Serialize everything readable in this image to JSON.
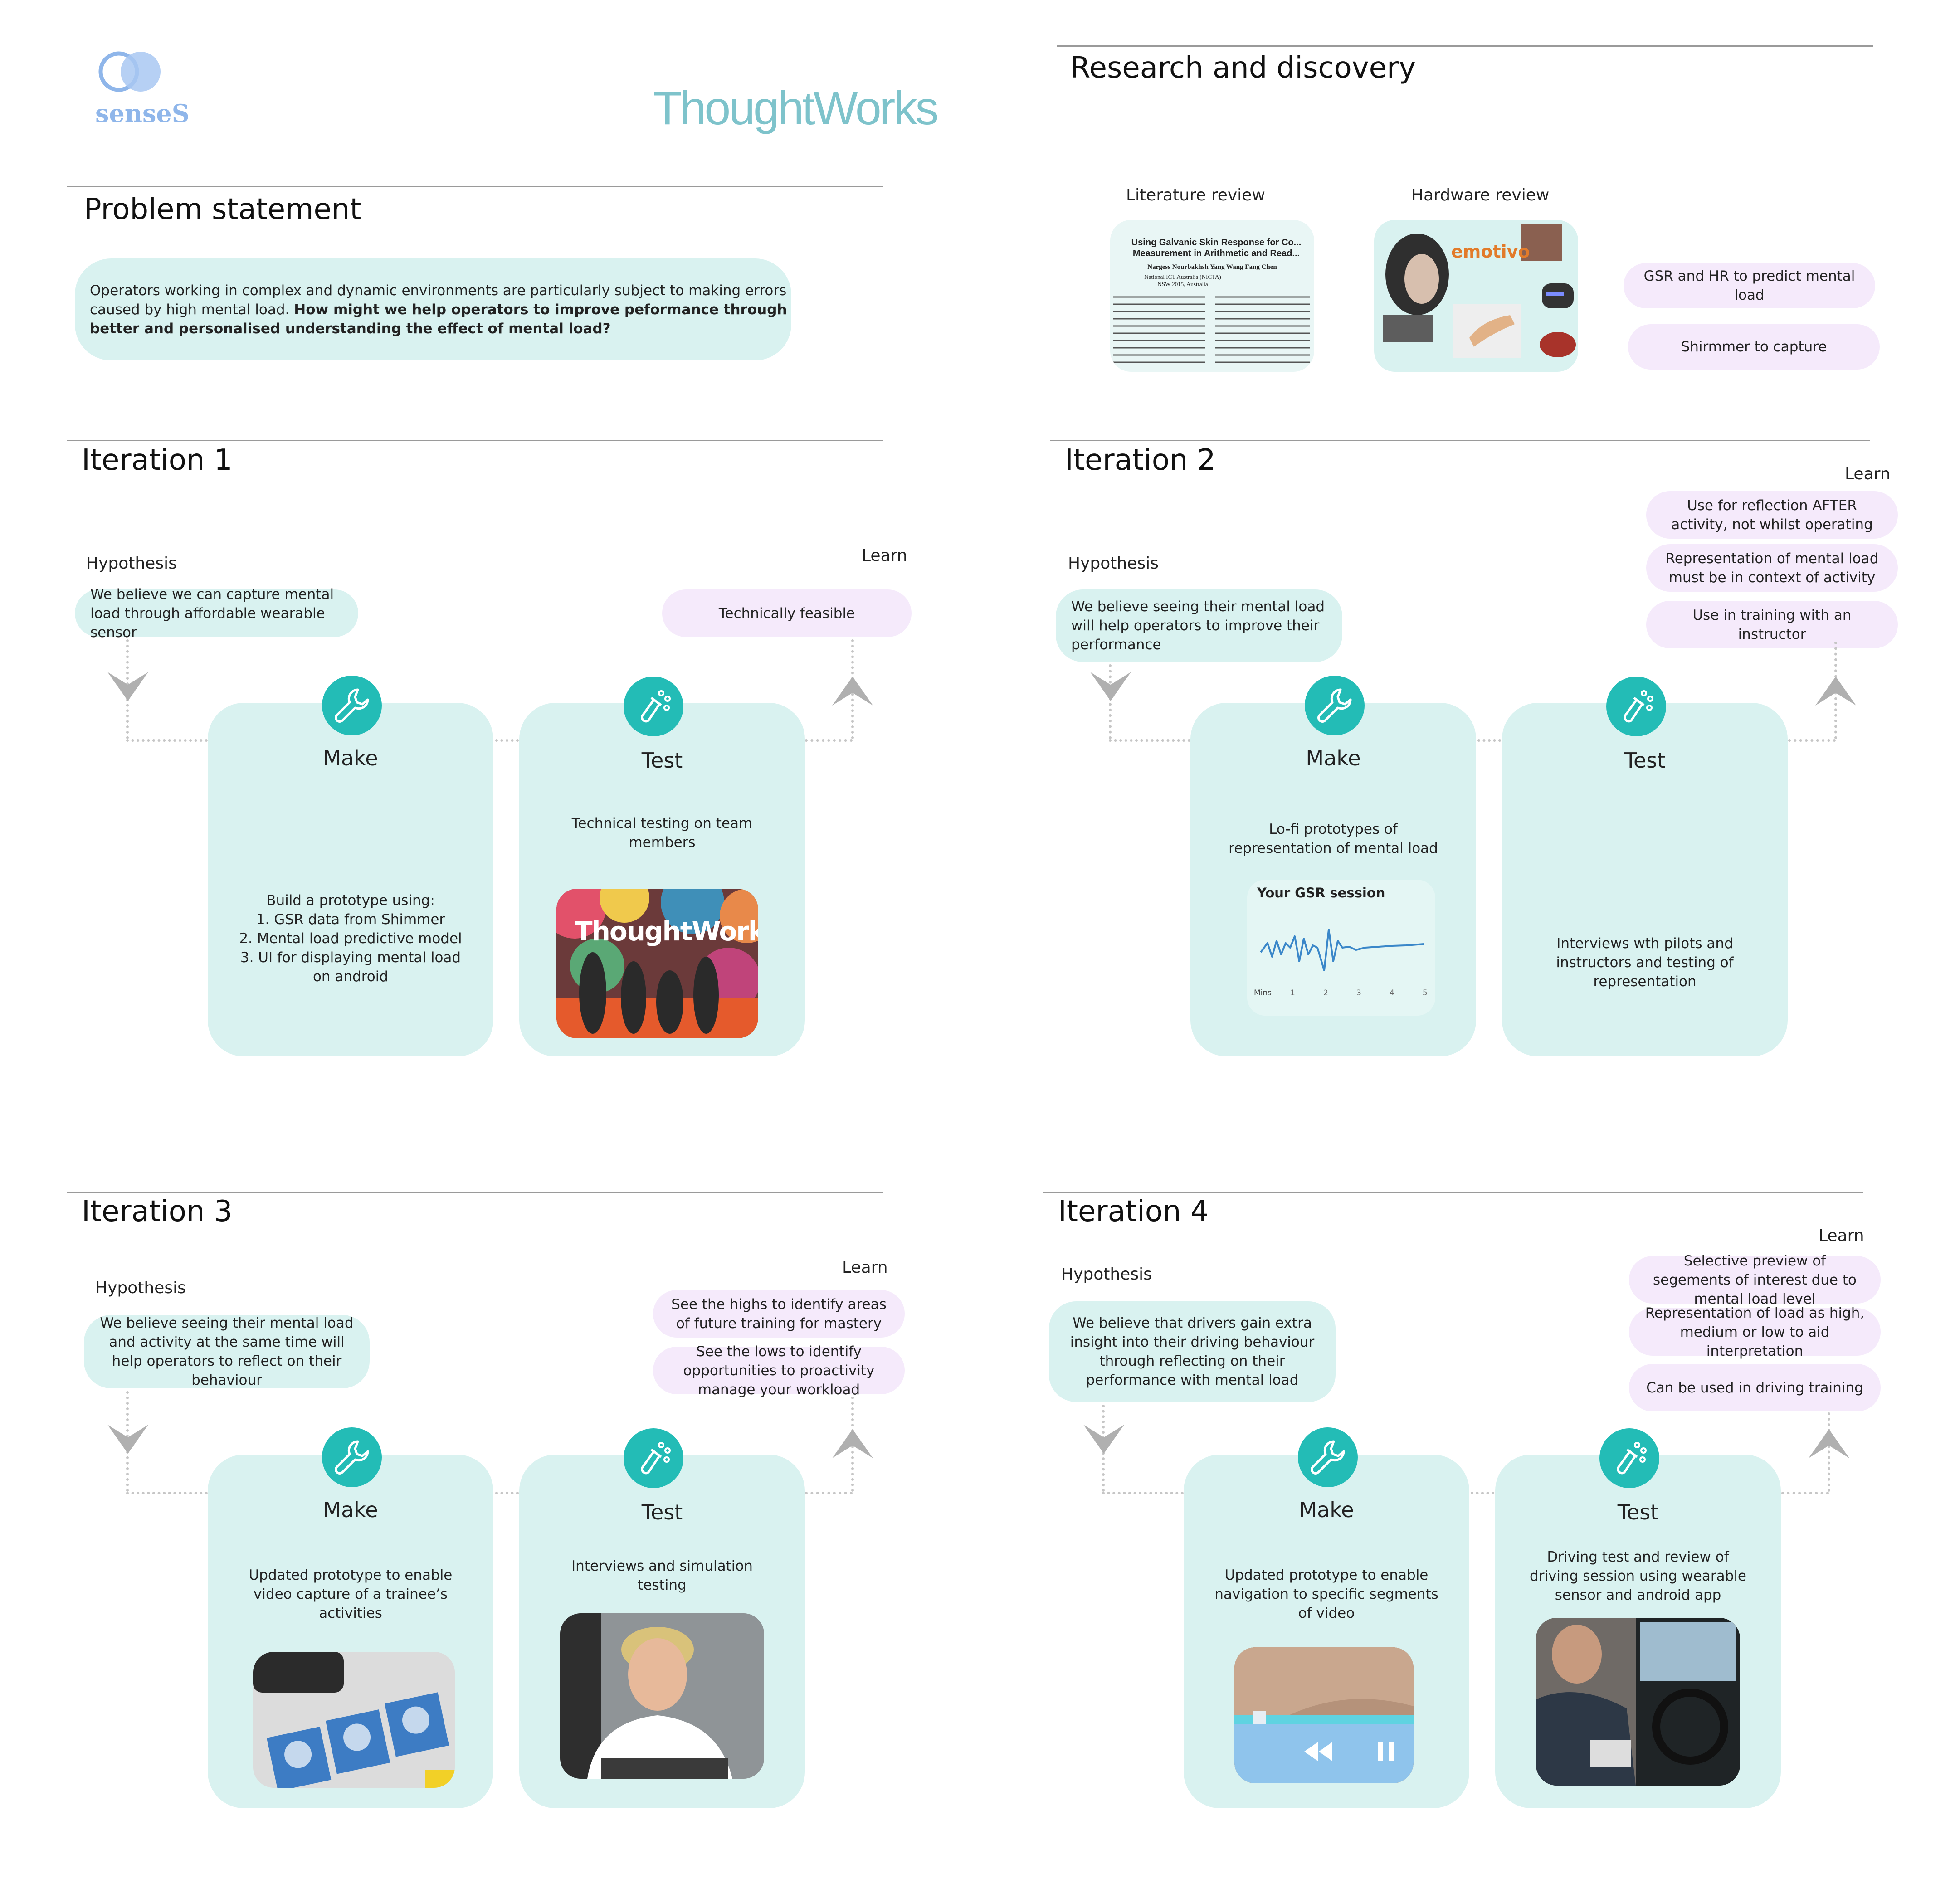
{
  "brand": {
    "logo_text": "senseS",
    "partner_logo": "ThoughtWorks"
  },
  "problem": {
    "title": "Problem statement",
    "text_plain": "Operators working in complex and dynamic environments are particularly subject to making errors caused by high mental load.",
    "text_bold": "How might we help operators to improve peformance through better and personalised understanding the effect of mental load?"
  },
  "research": {
    "title": "Research and discovery",
    "literature_label": "Literature review",
    "hardware_label": "Hardware review",
    "paper_title": "Using Galvanic Skin Response for Co... Measurement in Arithmetic and Read...",
    "paper_authors": "Nargess Nourbakhsh    Yang Wang    Fang Chen",
    "paper_affil": "National ICT Australia (NICTA) NSW 2015, Australia",
    "emotiv_text": "emotivo",
    "findings": [
      "GSR and HR to predict mental load",
      "Shirmmer to capture"
    ]
  },
  "iterations": [
    {
      "title": "Iteration 1",
      "hypothesis_label": "Hypothesis",
      "hypothesis": "We believe we can capture mental load through affordable wearable sensor",
      "learn_label": "Learn",
      "learn": [
        "Technically feasible"
      ],
      "make_title": "Make",
      "make_text": "Build a prototype using:\n1. GSR data from Shimmer\n2. Mental load predictive model\n3. UI for displaying mental load on android",
      "test_title": "Test",
      "test_text": "Technical testing on team members",
      "test_photo_text": "ThoughtWorks"
    },
    {
      "title": "Iteration 2",
      "hypothesis_label": "Hypothesis",
      "hypothesis": "We believe seeing their mental load will help operators  to improve their performance",
      "learn_label": "Learn",
      "learn": [
        "Use for reflection AFTER activity, not whilst operating",
        "Representation of mental load must be in context of activity",
        "Use in training with an instructor"
      ],
      "make_title": "Make",
      "make_text": "Lo-fi prototypes of representation of mental load",
      "gsr_title": "Your GSR session",
      "gsr_x_label": "Mins",
      "gsr_ticks": [
        "1",
        "2",
        "3",
        "4",
        "5"
      ],
      "test_title": "Test",
      "test_text": "Interviews wth pilots and instructors and testing of representation"
    },
    {
      "title": "Iteration 3",
      "hypothesis_label": "Hypothesis",
      "hypothesis": "We believe seeing their mental load and activity at the same time will help operators to reflect on their behaviour",
      "learn_label": "Learn",
      "learn": [
        "See the highs to identify areas of future training for mastery",
        "See the lows to identify opportunities to proactivity manage your workload"
      ],
      "make_title": "Make",
      "make_text": "Updated prototype to enable video capture of a trainee’s activities",
      "test_title": "Test",
      "test_text": "Interviews and simulation testing"
    },
    {
      "title": "Iteration 4",
      "hypothesis_label": "Hypothesis",
      "hypothesis": "We believe that drivers gain extra insight into their driving behaviour through reflecting on their performance with mental load",
      "learn_label": "Learn",
      "learn": [
        "Selective preview of segements of interest due to mental load level",
        "Representation of load as high, medium or low to aid interpretation",
        "Can be used in driving training"
      ],
      "make_title": "Make",
      "make_text": "Updated prototype to enable navigation to specific segments of video",
      "test_title": "Test",
      "test_text": "Driving test and review of driving session using wearable sensor and android app"
    }
  ],
  "colors": {
    "teal_bg": "#d9f2f0",
    "lilac_bg": "#f5eafb",
    "accent": "#23bcb6",
    "logo_blue": "#8fb6ea",
    "tw_teal": "#7ec3cb"
  },
  "icons": [
    "wrench-icon",
    "test-tube-icon",
    "arrow-down-icon",
    "arrow-up-icon"
  ]
}
